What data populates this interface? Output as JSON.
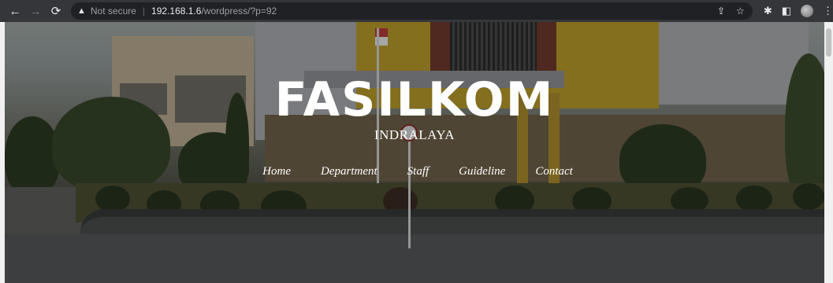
{
  "browser": {
    "security_label": "Not secure",
    "url_host": "192.168.1.6",
    "url_path": "/wordpress/?p=92"
  },
  "site": {
    "title": "FASILKOM",
    "subtitle": "INDRALAYA",
    "nav": [
      "Home",
      "Department",
      "Staff",
      "Guideline",
      "Contact"
    ]
  }
}
